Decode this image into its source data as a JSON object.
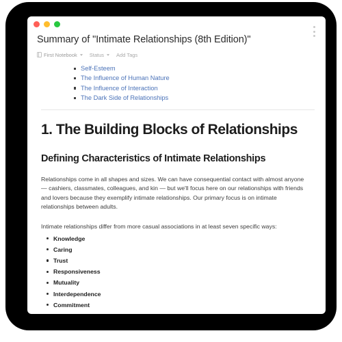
{
  "window": {
    "traffic_lights": [
      {
        "name": "close",
        "color": "#ff5f57"
      },
      {
        "name": "minimize",
        "color": "#ffbd2e"
      },
      {
        "name": "maximize",
        "color": "#28c840"
      }
    ],
    "more_menu_icon": "kebab-menu-icon"
  },
  "note": {
    "title": "Summary of \"Intimate Relationships (8th Edition)\"",
    "meta": {
      "notebook_icon": "notebook-icon",
      "notebook_label": "First Notebook",
      "status_label": "Status",
      "add_tags_label": "Add Tags"
    },
    "toc": {
      "items": [
        {
          "label": "Self-Esteem"
        },
        {
          "label": "The Influence of Human Nature"
        },
        {
          "label": "The Influence of Interaction"
        },
        {
          "label": "The Dark Side of Relationships"
        }
      ]
    },
    "chapter_heading": "1. The Building Blocks of Relationships",
    "section_heading": "Defining Characteristics of Intimate Relationships",
    "paragraph_1": "Relationships come in all shapes and sizes. We can have consequential contact with almost anyone — cashiers, classmates, colleagues, and kin — but we'll focus here on our relationships with friends and lovers because they exemplify intimate relationships. Our primary focus is on intimate relationships between adults.",
    "paragraph_2": "Intimate relationships differ from more casual associations in at least seven specific ways:",
    "ways": [
      {
        "label": "Knowledge"
      },
      {
        "label": "Caring"
      },
      {
        "label": "Trust"
      },
      {
        "label": "Responsiveness"
      },
      {
        "label": "Mutuality"
      },
      {
        "label": "Interdependence"
      },
      {
        "label": "Commitment"
      }
    ]
  },
  "colors": {
    "link": "#4a72b8",
    "text": "#3c3c3c",
    "heading": "#1d1d1d",
    "meta": "#a8a8a8",
    "shell": "#000000"
  }
}
